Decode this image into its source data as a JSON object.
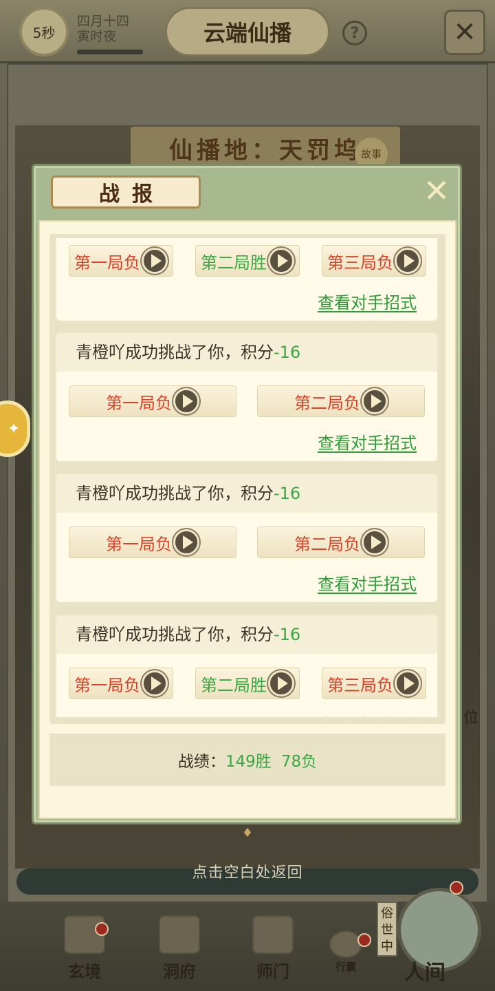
{
  "topbar": {
    "timer": "5秒",
    "date_line1": "四月十四",
    "date_line2": "寅时夜",
    "title": "云端仙播",
    "help_glyph": "?",
    "close_glyph": "✕"
  },
  "scene": {
    "location": "仙播地：天罚坞",
    "story_tag": "故事",
    "side_char": "位"
  },
  "modal": {
    "title": "战报",
    "close_glyph": "✕",
    "reports": [
      {
        "text": "",
        "score": "",
        "rounds": [
          {
            "label": "第一局负",
            "result": "lose"
          },
          {
            "label": "第二局胜",
            "result": "win"
          },
          {
            "label": "第三局负",
            "result": "lose"
          }
        ],
        "link": "查看对手招式"
      },
      {
        "text": "青橙吖成功挑战了你，积分",
        "score": "-16",
        "rounds": [
          {
            "label": "第一局负",
            "result": "lose"
          },
          {
            "label": "第二局负",
            "result": "lose"
          }
        ],
        "link": "查看对手招式"
      },
      {
        "text": "青橙吖成功挑战了你，积分",
        "score": "-16",
        "rounds": [
          {
            "label": "第一局负",
            "result": "lose"
          },
          {
            "label": "第二局负",
            "result": "lose"
          }
        ],
        "link": "查看对手招式"
      },
      {
        "text": "青橙吖成功挑战了你，积分",
        "score": "-16",
        "rounds": [
          {
            "label": "第一局负",
            "result": "lose"
          },
          {
            "label": "第二局胜",
            "result": "win"
          },
          {
            "label": "第三局负",
            "result": "lose"
          }
        ],
        "link": "查看对手招式"
      }
    ],
    "record": {
      "label": "战绩：",
      "wins": "149胜",
      "losses": "78负"
    }
  },
  "footer": {
    "return_hint": "点击空白处返回"
  },
  "nav": {
    "items": [
      {
        "label": "玄境",
        "icon": "scroll-icon"
      },
      {
        "label": "洞府",
        "icon": "pavilion-icon"
      },
      {
        "label": "师门",
        "icon": "banner-icon"
      },
      {
        "label": "行囊",
        "icon": "bag-icon"
      }
    ],
    "world_tag": "俗世中",
    "world_label": "人间"
  },
  "colors": {
    "lose": "#d8432a",
    "win": "#3aa843",
    "link": "#2f9c3a",
    "panel": "#fbf6dc",
    "modal_frame": "#a9b98f"
  }
}
